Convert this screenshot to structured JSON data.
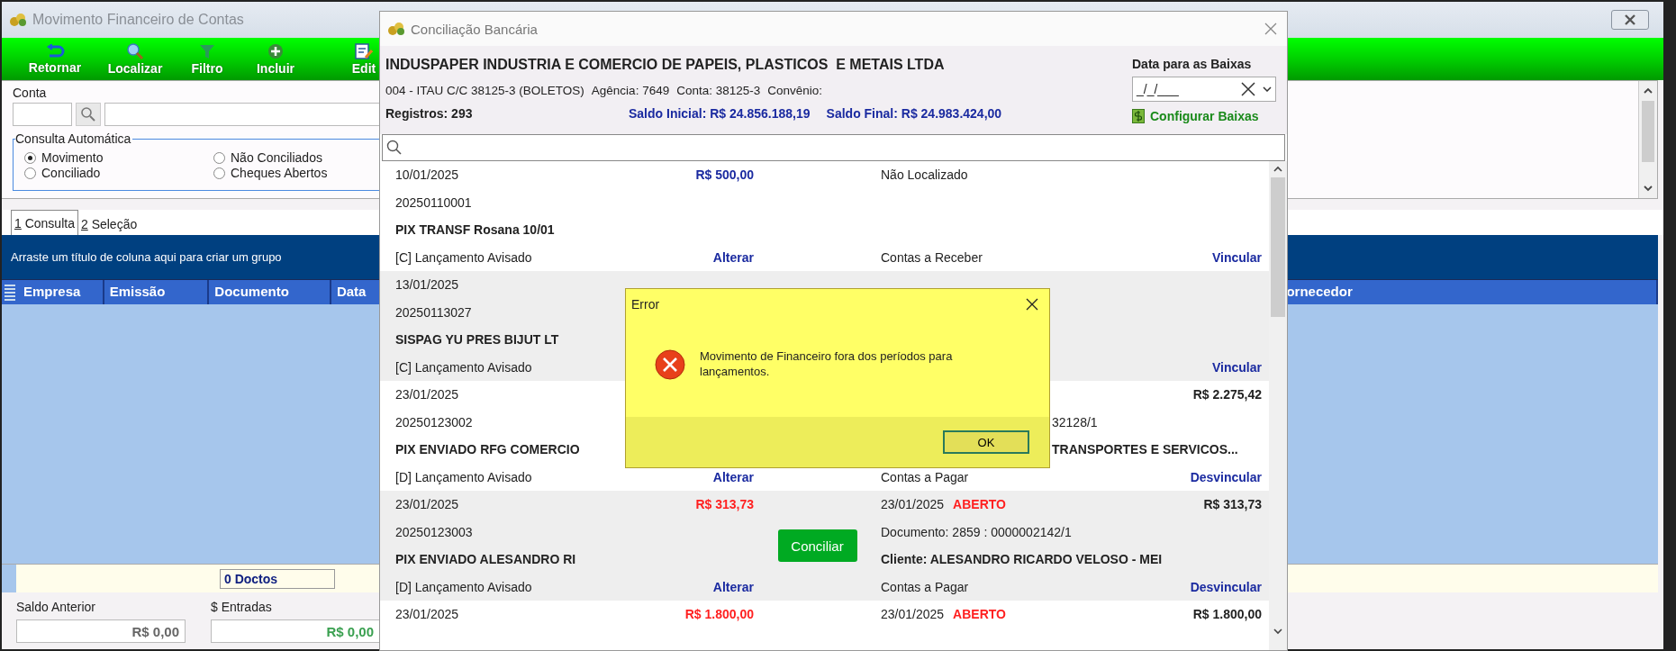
{
  "main_window": {
    "title": "Movimento Financeiro de Contas",
    "toolbar": [
      {
        "label": "Retornar"
      },
      {
        "label": "Localizar"
      },
      {
        "label": "Filtro"
      },
      {
        "label": "Incluir"
      },
      {
        "label": "Edit"
      }
    ],
    "conta": {
      "label": "Conta"
    },
    "consulta_automatica": {
      "title": "Consulta Automática",
      "options": [
        {
          "label": "Movimento",
          "selected": true
        },
        {
          "label": "Não Conciliados",
          "selected": false
        },
        {
          "label": "Conciliado",
          "selected": false
        },
        {
          "label": "Cheques Abertos",
          "selected": false
        }
      ]
    },
    "tabs": [
      {
        "hotkey": "1",
        "label": "Consulta",
        "selected": true
      },
      {
        "hotkey": "2",
        "label": "Seleção",
        "selected": false
      }
    ],
    "group_panel": "Arraste um título de coluna aqui para criar um grupo",
    "grid": {
      "columns": [
        "Empresa",
        "Emissão",
        "Documento",
        "Data",
        "ornecedor"
      ],
      "footer_count": "0 Doctos"
    },
    "totals": [
      {
        "label": "Saldo Anterior",
        "value": "R$ 0,00",
        "kind": "neutral"
      },
      {
        "label": "$ Entradas",
        "value": "R$ 0,00",
        "kind": "positive"
      }
    ]
  },
  "conciliation_dialog": {
    "title": "Conciliação Bancária",
    "company": "INDUSPAPER INDUSTRIA E COMERCIO DE PAPEIS, PLASTICOS  E METAIS LTDA",
    "account_info": [
      "004 - ITAU C/C 38125-3 (BOLETOS)",
      "Agência: 7649",
      "Conta: 38125-3",
      "Convênio:"
    ],
    "records": "Registros: 293",
    "initial_balance": "Saldo Inicial: R$ 24.856.188,19",
    "final_balance": "Saldo Final: R$ 24.983.424,00",
    "date_label": "Data para as Baixas",
    "date_value": "_/_/___",
    "configure_link": "Configurar Baixas",
    "rows": [
      {
        "kind": "credit",
        "date": "10/01/2025",
        "amount": "R$ 500,00",
        "code": "20250110001",
        "description": "PIX TRANSF Rosana 10/01",
        "entry_type": "[C] Lançamento Avisado",
        "edit_link": "Alterar",
        "match_status": "Não Localizado",
        "account_type": "Contas a Receber",
        "link_action": "Vincular"
      },
      {
        "date": "13/01/2025",
        "code": "20250113027",
        "description": "SISPAG  YU PRES BIJUT LT",
        "entry_type": "[C] Lançamento Avisado",
        "link_action": "Vincular"
      },
      {
        "date": "23/01/2025",
        "match_amount": "R$ 2.275,42",
        "code": "20250123002",
        "document_tail": "32128/1",
        "description": "PIX ENVIADO RFG COMERCIO",
        "client_tail": "TRANSPORTES E SERVICOS...",
        "entry_type": "[D] Lançamento Avisado",
        "edit_link": "Alterar",
        "account_type": "Contas a Pagar",
        "link_action": "Desvincular"
      },
      {
        "kind": "debit",
        "date": "23/01/2025",
        "amount": "R$ 313,73",
        "match_date": "23/01/2025",
        "open_status": "ABERTO",
        "match_amount": "R$ 313,73",
        "code": "20250123003",
        "document": "Documento: 2859 : 0000002142/1",
        "button": "Conciliar",
        "description": "PIX ENVIADO ALESANDRO RI",
        "client": "Cliente: ALESANDRO RICARDO VELOSO - MEI",
        "entry_type": "[D] Lançamento Avisado",
        "edit_link": "Alterar",
        "account_type": "Contas a Pagar",
        "link_action": "Desvincular"
      },
      {
        "kind": "debit",
        "date": "23/01/2025",
        "amount": "R$ 1.800,00",
        "match_date": "23/01/2025",
        "open_status": "ABERTO",
        "match_amount": "R$ 1.800,00"
      }
    ]
  },
  "error_dialog": {
    "title": "Error",
    "message": "Movimento de Financeiro fora dos períodos para lançamentos.",
    "button": "OK"
  }
}
